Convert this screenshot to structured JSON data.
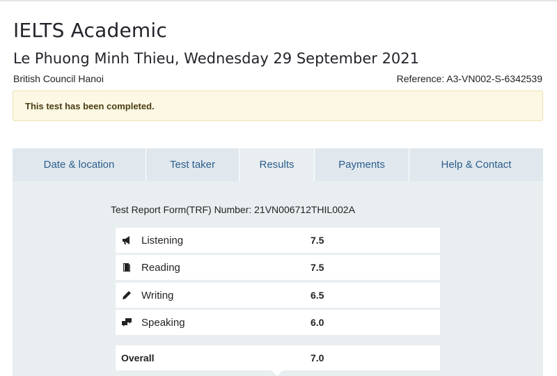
{
  "header": {
    "title": "IELTS Academic",
    "subtitle": "Le Phuong Minh Thieu, Wednesday 29 September 2021",
    "centre": "British Council Hanoi",
    "reference": "Reference: A3-VN002-S-6342539"
  },
  "alert": {
    "message": "This test has been completed."
  },
  "tabs": [
    {
      "label": "Date & location",
      "active": false
    },
    {
      "label": "Test taker",
      "active": false
    },
    {
      "label": "Results",
      "active": true
    },
    {
      "label": "Payments",
      "active": false
    },
    {
      "label": "Help & Contact",
      "active": false
    }
  ],
  "results": {
    "trf": "Test Report Form(TRF) Number: 21VN006712THIL002A",
    "scores": [
      {
        "label": "Listening",
        "value": "7.5",
        "icon": "megaphone-icon"
      },
      {
        "label": "Reading",
        "value": "7.5",
        "icon": "book-icon"
      },
      {
        "label": "Writing",
        "value": "6.5",
        "icon": "pencil-icon"
      },
      {
        "label": "Speaking",
        "value": "6.0",
        "icon": "speech-bubbles-icon"
      }
    ],
    "overall": {
      "label": "Overall",
      "value": "7.0"
    }
  },
  "colors": {
    "tab_link": "#2c5d8a",
    "panel_bg": "#e9eef1",
    "tab_bg": "#e0e8ee",
    "alert_bg": "#fcf8e3"
  }
}
